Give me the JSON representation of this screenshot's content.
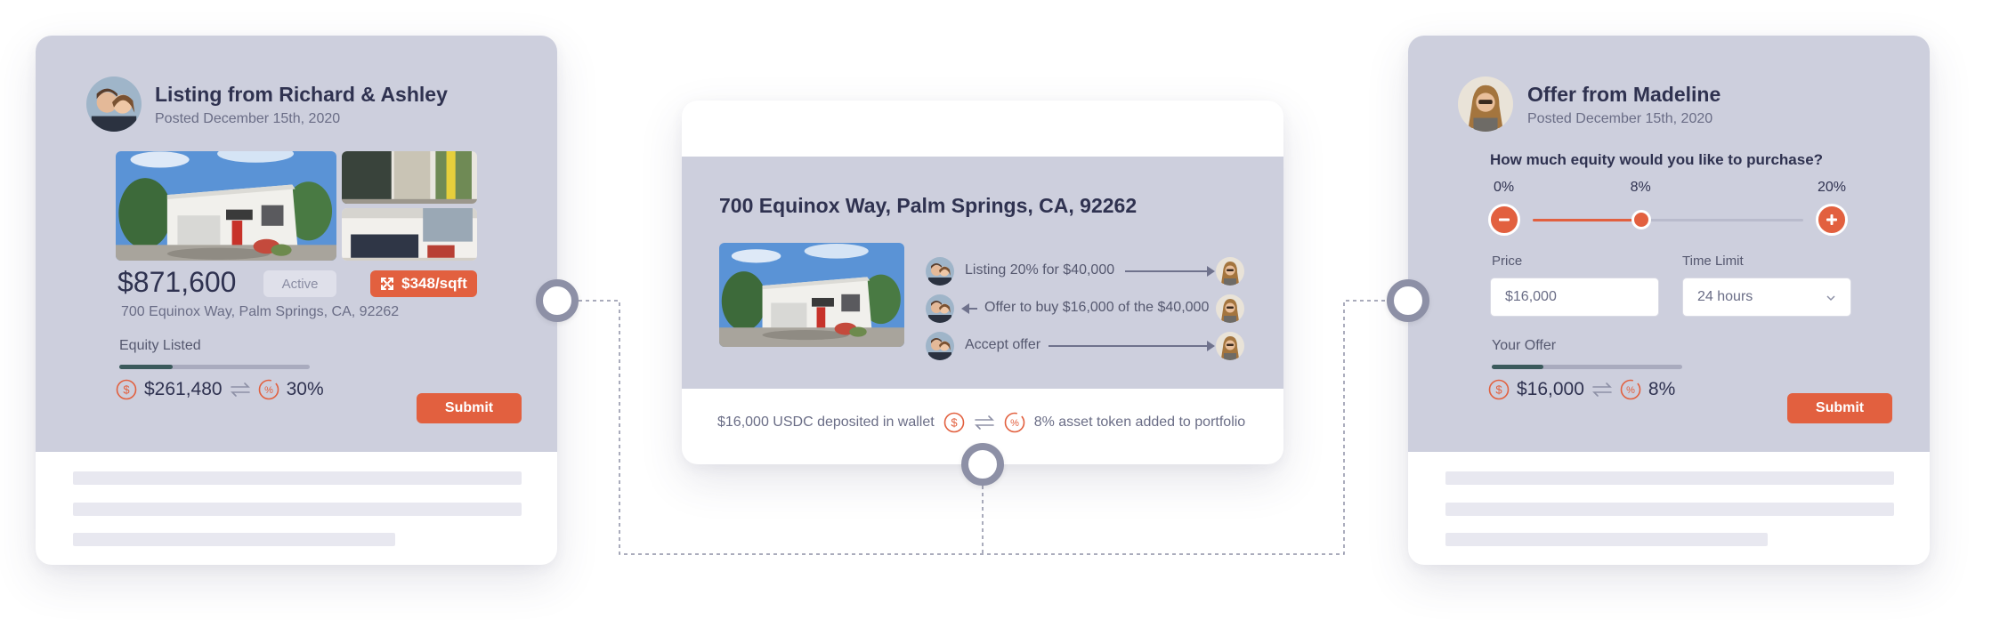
{
  "listing_card": {
    "title": "Listing from Richard & Ashley",
    "posted": "Posted December 15th, 2020",
    "price": "$871,600",
    "status": "Active",
    "price_per_sqft": "$348/sqft",
    "address": "700 Equinox Way, Palm Springs, CA, 92262",
    "equity_label": "Equity Listed",
    "equity_progress": 0.28,
    "equity_value": "$261,480",
    "equity_percent": "30%",
    "submit_label": "Submit"
  },
  "transaction_card": {
    "address_title": "700 Equinox Way, Palm Springs, CA, 92262",
    "steps": [
      {
        "text": "Listing 20% for $40,000",
        "direction": "right"
      },
      {
        "text": "Offer to buy $16,000 of the $40,000",
        "direction": "left"
      },
      {
        "text": "Accept offer",
        "direction": "right"
      }
    ],
    "deposit_text": "$16,000 USDC deposited in wallet",
    "token_text": "8% asset token added to portfolio"
  },
  "offer_card": {
    "title": "Offer from Madeline",
    "posted": "Posted December 15th, 2020",
    "question": "How much equity would you like to purchase?",
    "slider": {
      "min_label": "0%",
      "value_label": "8%",
      "max_label": "20%",
      "min": 0,
      "max": 20,
      "value": 8
    },
    "price_label": "Price",
    "price_value": "$16,000",
    "time_limit_label": "Time Limit",
    "time_limit_value": "24 hours",
    "your_offer_label": "Your Offer",
    "offer_progress": 0.27,
    "offer_value": "$16,000",
    "offer_percent": "8%",
    "submit_label": "Submit"
  },
  "colors": {
    "accent": "#e2603f",
    "panel": "#cdcfdd",
    "text_dark": "#2f3250",
    "node_ring": "#8d90a6"
  },
  "icons": {
    "expand": "expand-arrows-icon",
    "dollar_coin": "dollar-coin-icon",
    "percent_coin": "percent-coin-icon",
    "swap": "swap-arrows-icon",
    "minus": "minus-icon",
    "plus": "plus-icon",
    "chevron": "chevron-down-icon"
  }
}
